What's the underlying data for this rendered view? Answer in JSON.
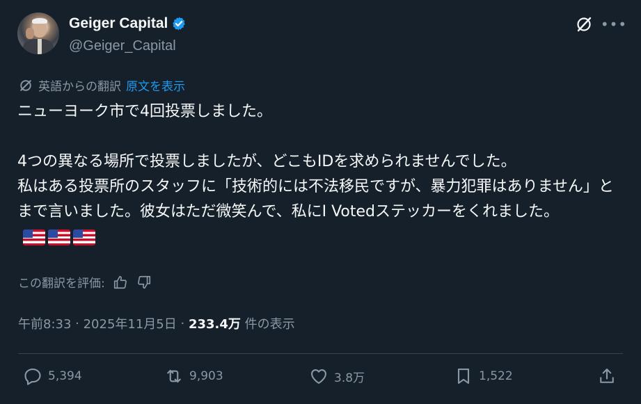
{
  "author": {
    "display_name": "Geiger Capital",
    "handle": "@Geiger_Capital",
    "verified": true,
    "verified_color": "#1d9bf0"
  },
  "translation": {
    "note": "英語からの翻訳",
    "show_original": "原文を表示"
  },
  "tweet": {
    "paragraph1": "ニューヨーク市で4回投票しました。",
    "paragraph2": "4つの異なる場所で投票しましたが、どこもIDを求められませんでした。\n私はある投票所のスタッフに「技術的には不法移民ですが、暴力犯罪はありません」とまで言いました。彼女はただ微笑んで、私にI Votedステッカーをくれました。",
    "emoji": [
      "us-flag",
      "us-flag",
      "us-flag"
    ]
  },
  "rate": {
    "label": "この翻訳を評価:"
  },
  "meta": {
    "time": "午前8:33",
    "sep1": " · ",
    "date": "2025年11月5日",
    "sep2": " · ",
    "views": "233.4万",
    "views_label": " 件の表示"
  },
  "actions": {
    "reply_count": "5,394",
    "retweet_count": "9,903",
    "like_count": "3.8万",
    "bookmark_count": "1,522"
  },
  "icons": [
    "grok-icon",
    "more-icon",
    "thumbs-up-icon",
    "thumbs-down-icon",
    "reply-icon",
    "retweet-icon",
    "like-icon",
    "bookmark-icon",
    "share-icon"
  ],
  "colors": {
    "background": "#15202b",
    "text": "#f7f9f9",
    "muted": "#8b98a5",
    "accent": "#1d9bf0"
  }
}
